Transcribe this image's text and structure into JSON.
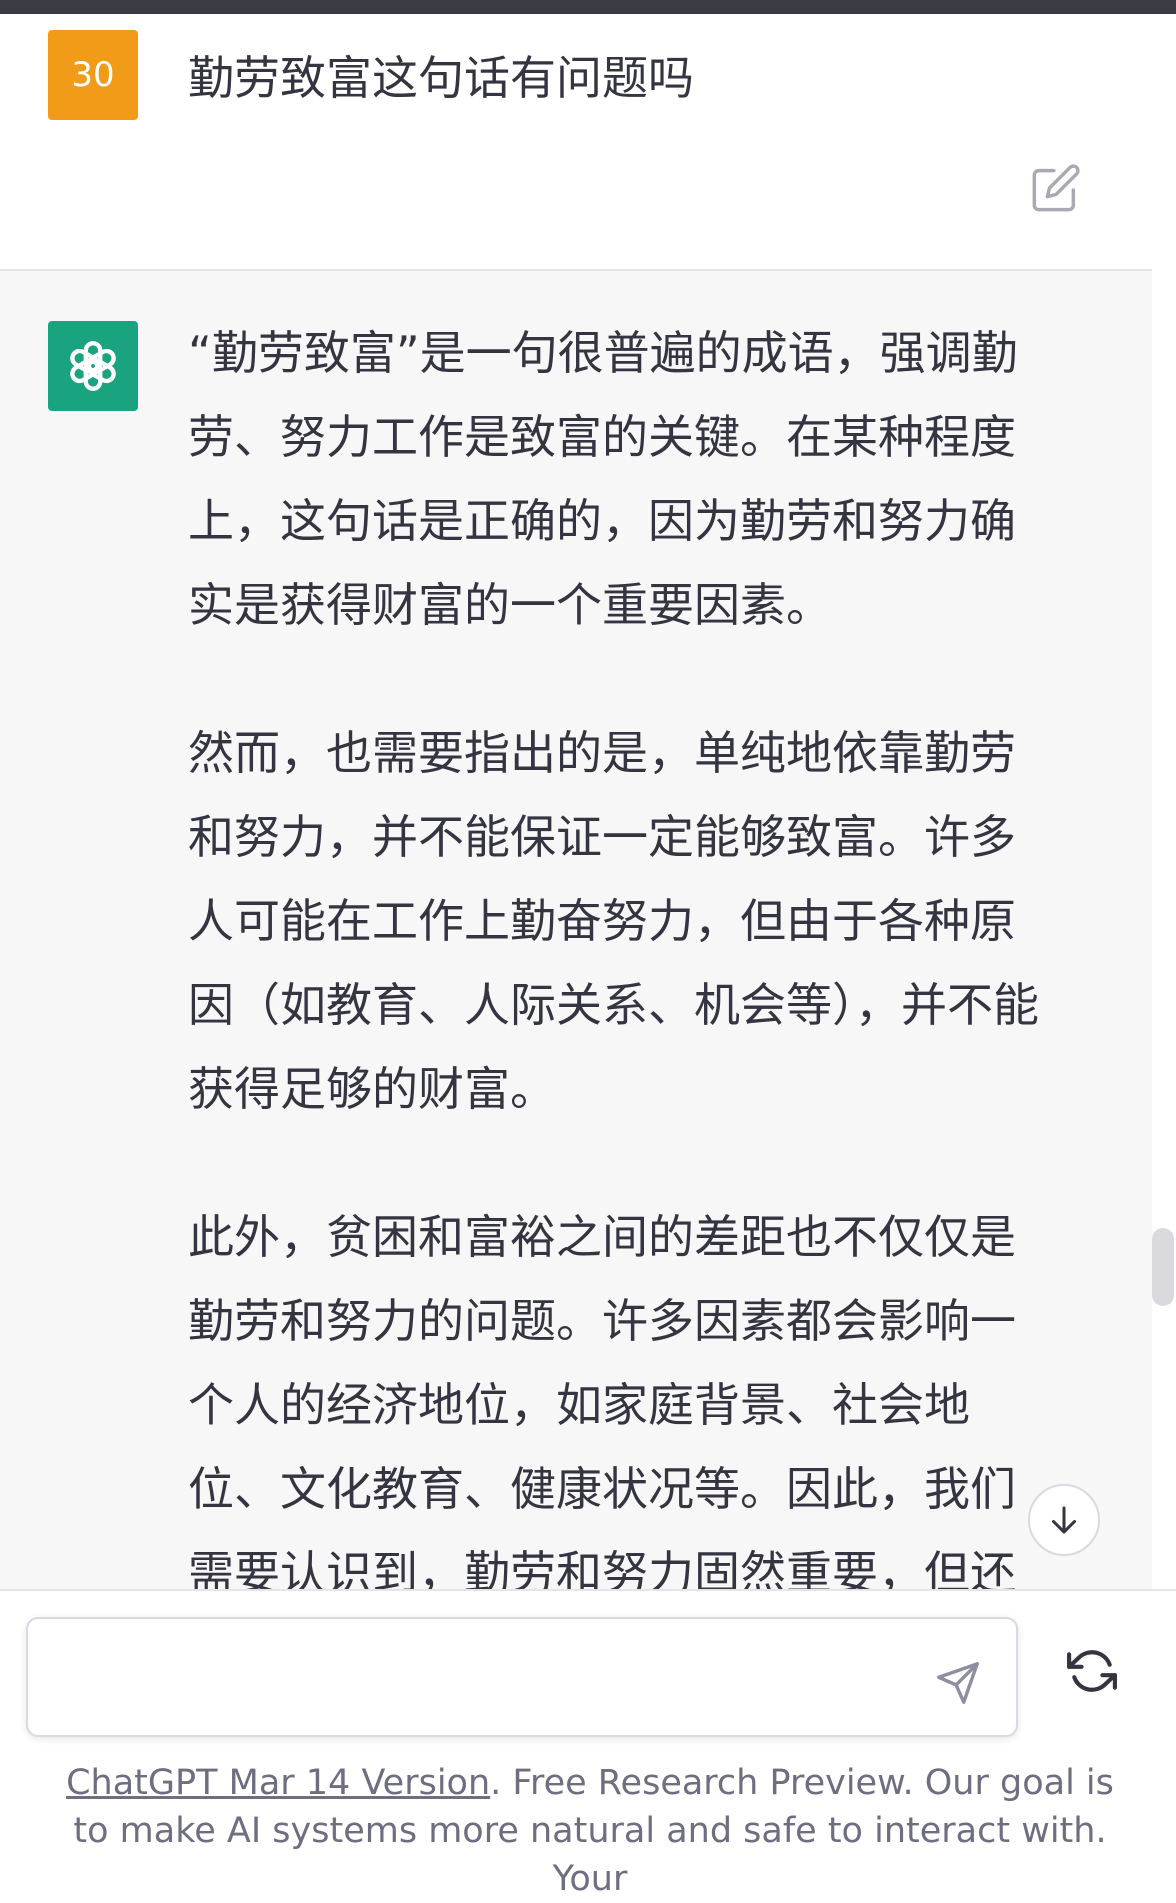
{
  "user": {
    "avatar_text": "30",
    "message": "勤劳致富这句话有问题吗",
    "avatar_color": "#f19b18"
  },
  "assistant": {
    "avatar_icon": "openai-logo-icon",
    "avatar_color": "#19a37f",
    "paragraphs": [
      "“勤劳致富”是一句很普遍的成语，强调勤劳、努力工作是致富的关键。在某种程度上，这句话是正确的，因为勤劳和努力确实是获得财富的一个重要因素。",
      "然而，也需要指出的是，单纯地依靠勤劳和努力，并不能保证一定能够致富。许多人可能在工作上勤奋努力，但由于各种原因（如教育、人际关系、机会等），并不能获得足够的财富。",
      "此外，贫困和富裕之间的差距也不仅仅是勤劳和努力的问题。许多因素都会影响一个人的经济地位，如家庭背景、社会地位、文化教育、健康状况等。因此，我们需要认识到，勤劳和努力固然重要，但还"
    ]
  },
  "input": {
    "value": "",
    "placeholder": ""
  },
  "icons": {
    "edit": "edit-icon",
    "send": "send-icon",
    "regenerate": "regenerate-icon",
    "scroll_down": "arrow-down-icon"
  },
  "footer": {
    "link_text": "ChatGPT Mar 14 Version",
    "text": ". Free Research Preview. Our goal is to make AI systems more natural and safe to interact with. Your"
  }
}
